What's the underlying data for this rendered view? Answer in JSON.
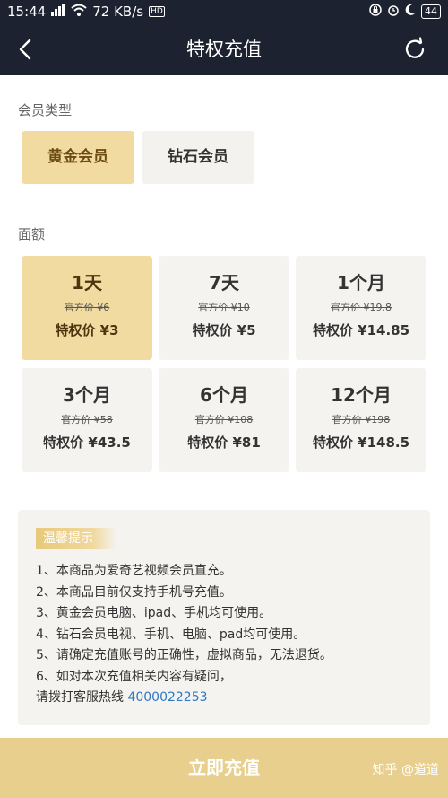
{
  "status": {
    "time": "15:44",
    "speed": "72 KB/s",
    "hd": "HD",
    "battery": "44"
  },
  "nav": {
    "title": "特权充值",
    "back_icon": "chevron-left-icon",
    "refresh_icon": "refresh-icon"
  },
  "member_type": {
    "label": "会员类型",
    "options": [
      {
        "label": "黄金会员",
        "selected": true
      },
      {
        "label": "钻石会员",
        "selected": false
      }
    ]
  },
  "denomination": {
    "label": "面额",
    "items": [
      {
        "duration": "1天",
        "original": "官方价 ¥6",
        "price": "特权价 ¥3",
        "selected": true
      },
      {
        "duration": "7天",
        "original": "官方价 ¥10",
        "price": "特权价 ¥5",
        "selected": false
      },
      {
        "duration": "1个月",
        "original": "官方价 ¥19.8",
        "price": "特权价 ¥14.85",
        "selected": false
      },
      {
        "duration": "3个月",
        "original": "官方价 ¥58",
        "price": "特权价 ¥43.5",
        "selected": false
      },
      {
        "duration": "6个月",
        "original": "官方价 ¥108",
        "price": "特权价 ¥81",
        "selected": false
      },
      {
        "duration": "12个月",
        "original": "官方价 ¥198",
        "price": "特权价 ¥148.5",
        "selected": false
      }
    ]
  },
  "tips": {
    "title": "温馨提示",
    "lines": [
      "1、本商品为爱奇艺视频会员直充。",
      "2、本商品目前仅支持手机号充值。",
      "3、黄金会员电脑、ipad、手机均可使用。",
      "4、钻石会员电视、手机、电脑、pad均可使用。",
      "5、请确定充值账号的正确性，虚拟商品，无法退货。",
      "6、如对本次充值相关内容有疑问，"
    ],
    "hotline_prefix": "请拨打客服热线 ",
    "hotline_number": "4000022253"
  },
  "submit": {
    "label": "立即充值"
  },
  "watermark": "知乎 @道道",
  "colors": {
    "header": "#1d2230",
    "gold": "#f2dba0",
    "submit": "#e8cf8d",
    "link": "#2f78c4"
  }
}
